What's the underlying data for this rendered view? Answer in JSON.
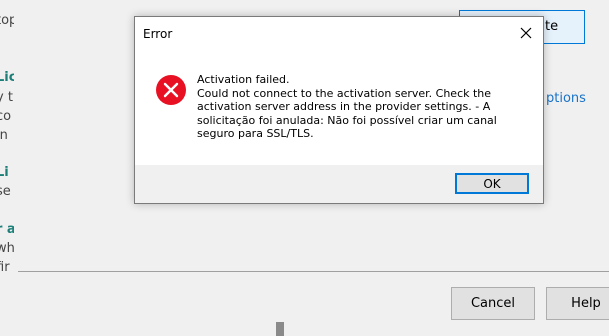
{
  "background": {
    "fragments": [
      {
        "text": "top",
        "style": "grey"
      },
      {
        "text": "Lic",
        "style": "teal"
      },
      {
        "text": "y t",
        "style": "grey"
      },
      {
        "text": "co",
        "style": "grey"
      },
      {
        "text": "in",
        "style": "grey"
      },
      {
        "text": "Li",
        "style": "teal"
      },
      {
        "text": "se",
        "style": "grey"
      },
      {
        "text": "r a",
        "style": "teal"
      },
      {
        "text": "wh",
        "style": "grey"
      },
      {
        "text": "fir",
        "style": "grey"
      }
    ],
    "top_button_label": "te",
    "options_link": "ptions",
    "cancel_label": "Cancel",
    "help_label": "Help"
  },
  "dialog": {
    "title": "Error",
    "message_lines": [
      "Activation failed.",
      "Could not connect to the activation server. Check the activation server address in the provider settings. - A solicitação foi anulada: Não foi possível criar um canal seguro para SSL/TLS."
    ],
    "ok_label": "OK"
  },
  "colors": {
    "error_icon": "#e81123",
    "focus_border": "#0078d7",
    "link": "#1a73c8",
    "teal": "#1b7f78"
  }
}
